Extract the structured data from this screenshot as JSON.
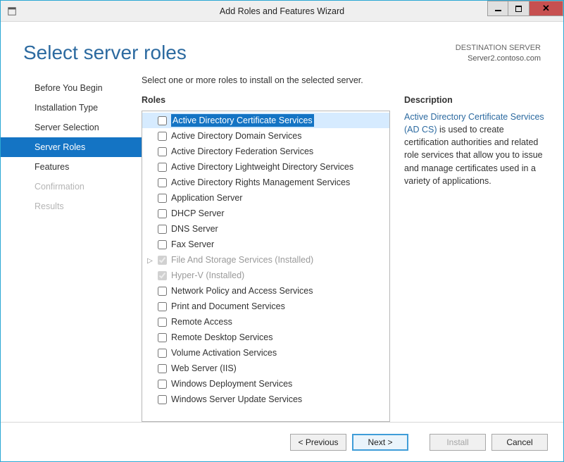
{
  "titlebar": {
    "title": "Add Roles and Features Wizard"
  },
  "header": {
    "page_title": "Select server roles",
    "dest_label": "DESTINATION SERVER",
    "dest_value": "Server2.contoso.com"
  },
  "sidebar": {
    "items": [
      {
        "label": "Before You Begin",
        "state": "normal"
      },
      {
        "label": "Installation Type",
        "state": "normal"
      },
      {
        "label": "Server Selection",
        "state": "normal"
      },
      {
        "label": "Server Roles",
        "state": "active"
      },
      {
        "label": "Features",
        "state": "normal"
      },
      {
        "label": "Confirmation",
        "state": "disabled"
      },
      {
        "label": "Results",
        "state": "disabled"
      }
    ]
  },
  "main": {
    "instruction": "Select one or more roles to install on the selected server.",
    "roles_heading": "Roles",
    "desc_heading": "Description",
    "roles": [
      {
        "label": "Active Directory Certificate Services",
        "checked": false,
        "disabled": false,
        "selected": true,
        "expandable": false
      },
      {
        "label": "Active Directory Domain Services",
        "checked": false,
        "disabled": false
      },
      {
        "label": "Active Directory Federation Services",
        "checked": false,
        "disabled": false
      },
      {
        "label": "Active Directory Lightweight Directory Services",
        "checked": false,
        "disabled": false
      },
      {
        "label": "Active Directory Rights Management Services",
        "checked": false,
        "disabled": false
      },
      {
        "label": "Application Server",
        "checked": false,
        "disabled": false
      },
      {
        "label": "DHCP Server",
        "checked": false,
        "disabled": false
      },
      {
        "label": "DNS Server",
        "checked": false,
        "disabled": false
      },
      {
        "label": "Fax Server",
        "checked": false,
        "disabled": false
      },
      {
        "label": "File And Storage Services (Installed)",
        "checked": true,
        "disabled": true,
        "expandable": true
      },
      {
        "label": "Hyper-V (Installed)",
        "checked": true,
        "disabled": true
      },
      {
        "label": "Network Policy and Access Services",
        "checked": false,
        "disabled": false
      },
      {
        "label": "Print and Document Services",
        "checked": false,
        "disabled": false
      },
      {
        "label": "Remote Access",
        "checked": false,
        "disabled": false
      },
      {
        "label": "Remote Desktop Services",
        "checked": false,
        "disabled": false
      },
      {
        "label": "Volume Activation Services",
        "checked": false,
        "disabled": false
      },
      {
        "label": "Web Server (IIS)",
        "checked": false,
        "disabled": false
      },
      {
        "label": "Windows Deployment Services",
        "checked": false,
        "disabled": false
      },
      {
        "label": "Windows Server Update Services",
        "checked": false,
        "disabled": false
      }
    ],
    "description": {
      "link_text": "Active Directory Certificate Services (AD CS)",
      "body_text": " is used to create certification authorities and related role services that allow you to issue and manage certificates used in a variety of applications."
    }
  },
  "footer": {
    "previous": "< Previous",
    "next": "Next >",
    "install": "Install",
    "cancel": "Cancel"
  }
}
